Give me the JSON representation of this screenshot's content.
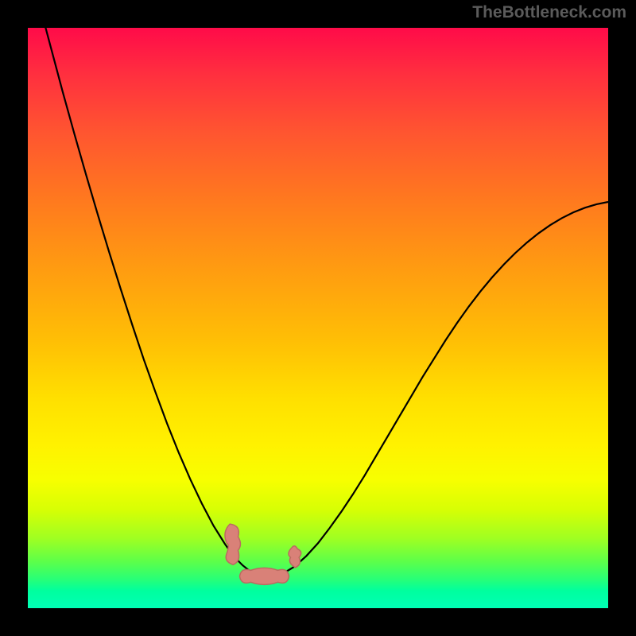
{
  "watermark": "TheBottleneck.com",
  "colors": {
    "page_bg": "#000000",
    "watermark_text": "#5b5b5b",
    "curve": "#000000",
    "marker_fill": "#d98178",
    "marker_stroke": "#bb6a61"
  },
  "chart_data": {
    "type": "line",
    "title": "",
    "xlabel": "",
    "ylabel": "",
    "xlim": [
      0,
      100
    ],
    "ylim": [
      0,
      100
    ],
    "x": [
      0,
      2,
      4,
      6,
      8,
      10,
      12,
      14,
      16,
      18,
      20,
      22,
      24,
      26,
      28,
      30,
      32,
      33,
      34,
      35,
      36,
      37,
      38,
      39,
      40,
      41,
      42,
      43,
      44,
      46,
      48,
      50,
      52,
      54,
      56,
      58,
      60,
      62,
      64,
      66,
      68,
      70,
      72,
      74,
      76,
      78,
      80,
      82,
      84,
      86,
      88,
      90,
      92,
      94,
      96,
      98,
      100
    ],
    "series": [
      {
        "name": "bottleneck-curve",
        "values": [
          112,
          104,
          96.5,
          89,
          81.8,
          74.8,
          68,
          61.4,
          55,
          48.8,
          42.8,
          37.2,
          31.8,
          26.8,
          22.2,
          18,
          14.2,
          12.6,
          11,
          9.6,
          8.4,
          7.4,
          6.6,
          6,
          5.6,
          5.4,
          5.4,
          5.6,
          6,
          7.2,
          9,
          11.2,
          13.8,
          16.6,
          19.6,
          22.8,
          26.2,
          29.6,
          33,
          36.4,
          39.8,
          43,
          46.2,
          49.2,
          52,
          54.6,
          57,
          59.2,
          61.2,
          63,
          64.6,
          66,
          67.2,
          68.2,
          69,
          69.6,
          70
        ]
      }
    ],
    "markers": [
      {
        "name": "left-cluster",
        "x_range": [
          34,
          36.5
        ],
        "y_range": [
          7.5,
          14.5
        ]
      },
      {
        "name": "bottom-span",
        "x_range": [
          36.5,
          45
        ],
        "y_range": [
          4.2,
          6.8
        ]
      },
      {
        "name": "right-cluster",
        "x_range": [
          45,
          47
        ],
        "y_range": [
          7,
          10.5
        ]
      }
    ],
    "background_gradient": "rainbow red-top to green-bottom"
  }
}
